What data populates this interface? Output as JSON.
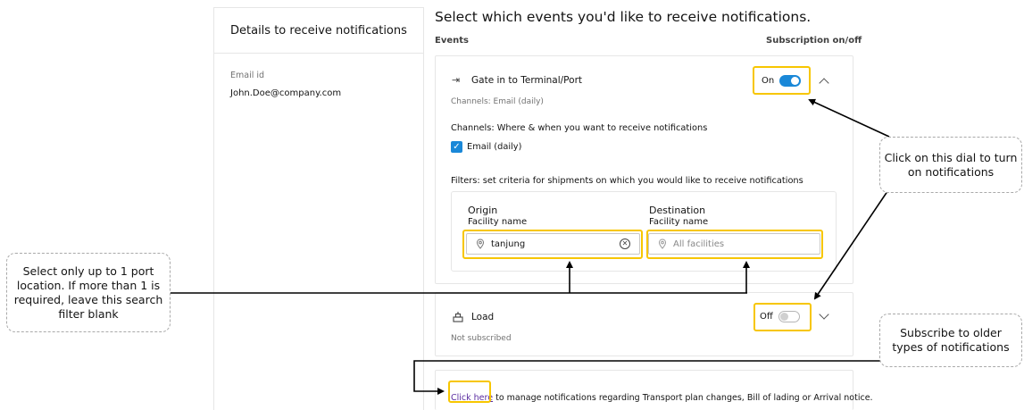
{
  "left_panel": {
    "title": "Details to receive notifications",
    "email_label": "Email id",
    "email_value": "John.Doe@company.com"
  },
  "main": {
    "title": "Select which events you'd like to receive notifications.",
    "col_events": "Events",
    "col_subscription": "Subscription on/off"
  },
  "event1": {
    "icon": "gate-in-icon",
    "name": "Gate in to Terminal/Port",
    "channels_summary": "Channels: Email (daily)",
    "toggle_label": "On",
    "toggle_state": "on",
    "channels_heading": "Channels: Where & when you want to receive notifications",
    "email_checkbox_label": "Email (daily)",
    "email_checked": true,
    "filters_heading": "Filters: set criteria for shipments on which you would like to receive notifications",
    "origin_label": "Origin",
    "origin_sub": "Facility name",
    "origin_value": "tanjung",
    "destination_label": "Destination",
    "destination_sub": "Facility name",
    "destination_placeholder": "All facilities"
  },
  "event2": {
    "icon": "load-icon",
    "name": "Load",
    "status": "Not subscribed",
    "toggle_label": "Off",
    "toggle_state": "off"
  },
  "footer": {
    "link_text": "Click here",
    "rest_text": " to manage notifications regarding Transport plan changes, Bill of lading or Arrival notice."
  },
  "callouts": {
    "dial": "Click on this dial to turn on notifications",
    "port": "Select only up to 1 port location. If more than 1 is required, leave this search filter blank",
    "older": "Subscribe to older types of notifications"
  },
  "colors": {
    "accent": "#1a88d8",
    "highlight": "#f7c600",
    "link": "#5a2ca0"
  }
}
